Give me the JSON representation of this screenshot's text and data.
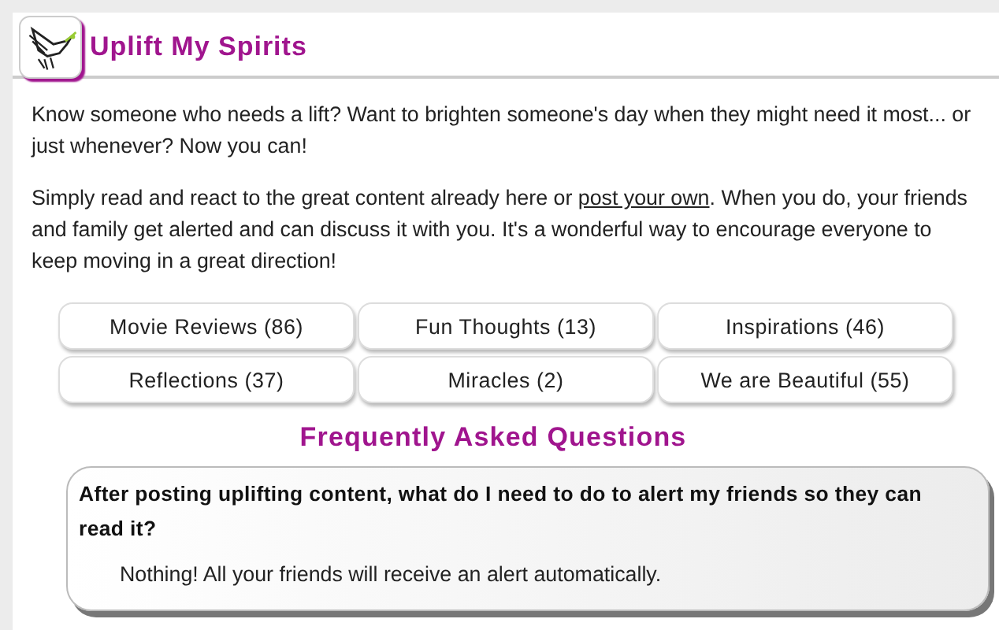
{
  "header": {
    "title": "Uplift My Spirits"
  },
  "intro": [
    "Know someone who needs a lift? Want to brighten someone's day when they might need it most... or just whenever? Now you can!"
  ],
  "call_to_action": {
    "before": "Simply read and react to the great content already here or ",
    "link": "post your own",
    "after": ". When you do, your friends and family get alerted and can discuss it with you. It's a wonderful way to encourage everyone to keep moving in a great direction!"
  },
  "categories": [
    {
      "label": "Movie Reviews (86)"
    },
    {
      "label": "Fun Thoughts (13)"
    },
    {
      "label": "Inspirations (46)"
    },
    {
      "label": "Reflections (37)"
    },
    {
      "label": "Miracles (2)"
    },
    {
      "label": "We are Beautiful (55)"
    }
  ],
  "faq": {
    "title": "Frequently Asked Questions",
    "items": [
      {
        "question": "After posting uplifting content, what do I need to do to alert my friends so they can read it?",
        "answer": "Nothing! All your friends will receive an alert automatically."
      }
    ]
  }
}
